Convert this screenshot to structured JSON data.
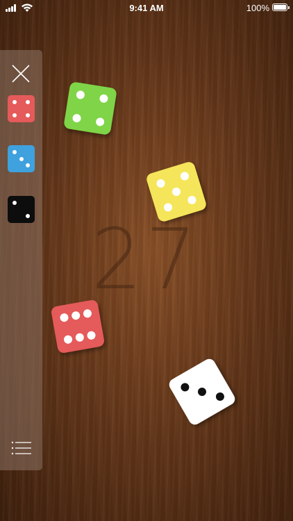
{
  "status_bar": {
    "time": "9:41 AM",
    "battery": "100%"
  },
  "sidebar": {
    "close_icon": "close-icon",
    "menu_icon": "list-menu-icon",
    "dice": [
      {
        "name": "red",
        "color": "#e55a5a",
        "pip_color": "#ffffff",
        "face": 4
      },
      {
        "name": "blue",
        "color": "#3fa1dd",
        "pip_color": "#ffffff",
        "face": 3
      },
      {
        "name": "black",
        "color": "#0d0d0d",
        "pip_color": "#ffffff",
        "face": 2
      }
    ]
  },
  "total": "27",
  "table_dice": [
    {
      "name": "green",
      "color": "#7fd447",
      "pip_color": "#ffffff",
      "face": 4
    },
    {
      "name": "yellow",
      "color": "#f5e55a",
      "pip_color": "#ffffff",
      "face": 5
    },
    {
      "name": "red",
      "color": "#e55a5a",
      "pip_color": "#ffffff",
      "face": 6
    },
    {
      "name": "white",
      "color": "#ffffff",
      "pip_color": "#111111",
      "face": 3
    }
  ]
}
